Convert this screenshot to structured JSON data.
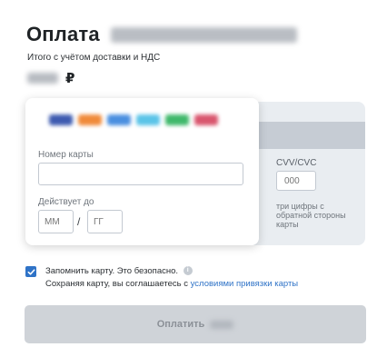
{
  "header": {
    "title": "Оплата"
  },
  "summary": {
    "label": "Итого с учётом доставки и НДС",
    "currency_symbol": "₽"
  },
  "card_form": {
    "card_number_label": "Номер карты",
    "card_number_value": "",
    "valid_thru_label": "Действует до",
    "month_placeholder": "ММ",
    "year_placeholder": "ГГ",
    "separator": "/",
    "cvv_label": "CVV/CVC",
    "cvv_placeholder": "000",
    "cvv_hint": "три цифры с обратной стороны карты",
    "payment_system_logos": [
      "visa-logo",
      "mastercard-logo",
      "maestro-logo",
      "mir-logo",
      "unionpay-logo",
      "jcb-logo"
    ]
  },
  "remember": {
    "checked": true,
    "text": "Запомнить карту. Это безопасно.",
    "consent_text": "Сохраняя карту, вы соглашаетесь с",
    "link_text": "условиями привязки карты"
  },
  "pay_button": {
    "label": "Оплатить"
  },
  "colors": {
    "accent": "#2f73c7",
    "button_disabled": "#cfd3d8",
    "card_back": "#e9edf1"
  }
}
